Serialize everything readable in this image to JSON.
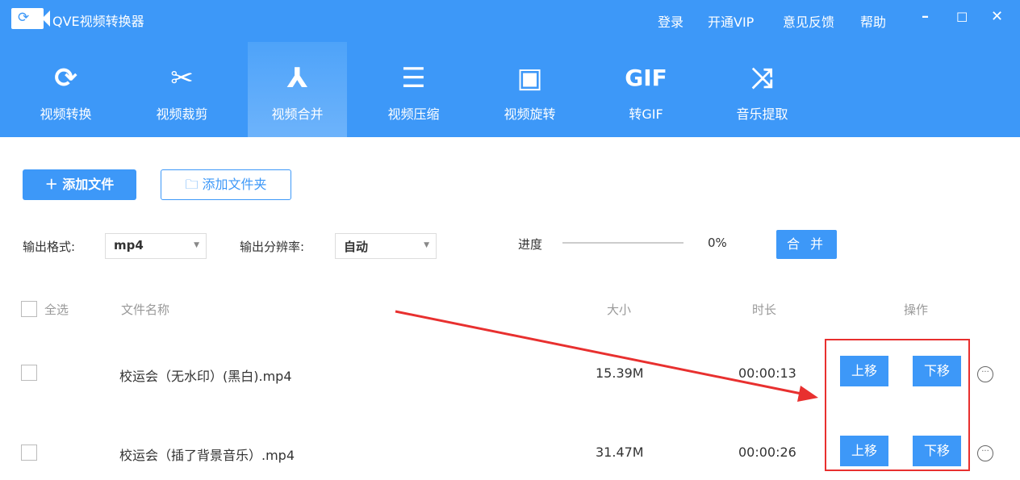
{
  "app": {
    "title": "QVE视频转换器"
  },
  "topnav": [
    "登录",
    "开通VIP",
    "意见反馈",
    "帮助"
  ],
  "tabs": [
    {
      "label": "视频转换",
      "icon": "refresh-icon"
    },
    {
      "label": "视频裁剪",
      "icon": "scissors-icon"
    },
    {
      "label": "视频合并",
      "icon": "merge-icon",
      "active": true
    },
    {
      "label": "视频压缩",
      "icon": "compress-icon"
    },
    {
      "label": "视频旋转",
      "icon": "rotate-icon"
    },
    {
      "label": "转GIF",
      "icon": "gif-icon",
      "glyph": "GIF"
    },
    {
      "label": "音乐提取",
      "icon": "shuffle-icon"
    }
  ],
  "toolbar": {
    "add_file": "添加文件",
    "add_folder": "添加文件夹"
  },
  "options": {
    "format_label": "输出格式:",
    "format_value": "mp4",
    "resolution_label": "输出分辨率:",
    "resolution_value": "自动",
    "progress_label": "进度",
    "progress_percent": "0%",
    "progress_value": 0,
    "merge_button": "合 并"
  },
  "table": {
    "headers": {
      "select_all": "全选",
      "name": "文件名称",
      "size": "大小",
      "duration": "时长",
      "actions": "操作"
    },
    "rows": [
      {
        "name": "校运会（无水印）(黑白).mp4",
        "size": "15.39M",
        "duration": "00:00:13"
      },
      {
        "name": "校运会（插了背景音乐）.mp4",
        "size": "31.47M",
        "duration": "00:00:26"
      }
    ],
    "move_up": "上移",
    "move_down": "下移"
  },
  "colors": {
    "accent": "#3d98f8",
    "annotation": "#e8302f"
  }
}
